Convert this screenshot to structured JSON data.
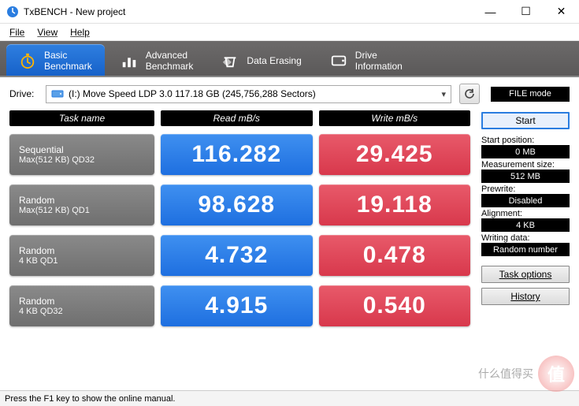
{
  "window": {
    "title": "TxBENCH - New project",
    "menu": [
      "File",
      "View",
      "Help"
    ],
    "status": "Press the F1 key to show the online manual."
  },
  "tabs": [
    {
      "line1": "Basic",
      "line2": "Benchmark"
    },
    {
      "line1": "Advanced",
      "line2": "Benchmark"
    },
    {
      "line1": "Data Erasing",
      "line2": ""
    },
    {
      "line1": "Drive",
      "line2": "Information"
    }
  ],
  "drive": {
    "label": "Drive:",
    "selected": "(I:) Move Speed LDP 3.0  117.18 GB (245,756,288 Sectors)",
    "file_mode": "FILE mode"
  },
  "headers": {
    "task": "Task name",
    "read": "Read mB/s",
    "write": "Write mB/s"
  },
  "rows": [
    {
      "t1": "Sequential",
      "t2": "Max(512 KB) QD32",
      "read": "116.282",
      "write": "29.425"
    },
    {
      "t1": "Random",
      "t2": "Max(512 KB) QD1",
      "read": "98.628",
      "write": "19.118"
    },
    {
      "t1": "Random",
      "t2": "4 KB QD1",
      "read": "4.732",
      "write": "0.478"
    },
    {
      "t1": "Random",
      "t2": "4 KB QD32",
      "read": "4.915",
      "write": "0.540"
    }
  ],
  "sidebar": {
    "start": "Start",
    "settings": [
      {
        "label": "Start position:",
        "value": "0 MB"
      },
      {
        "label": "Measurement size:",
        "value": "512 MB"
      },
      {
        "label": "Prewrite:",
        "value": "Disabled"
      },
      {
        "label": "Alignment:",
        "value": "4 KB"
      },
      {
        "label": "Writing data:",
        "value": "Random number"
      }
    ],
    "task_options": "Task options",
    "history": "History"
  },
  "watermark": {
    "glyph": "值",
    "text": "什么值得买"
  },
  "icons": {
    "app_color": "#2a7de0",
    "tab_colors": [
      "#ffb400",
      "#ffffff",
      "#ffffff",
      "#ffffff"
    ]
  }
}
